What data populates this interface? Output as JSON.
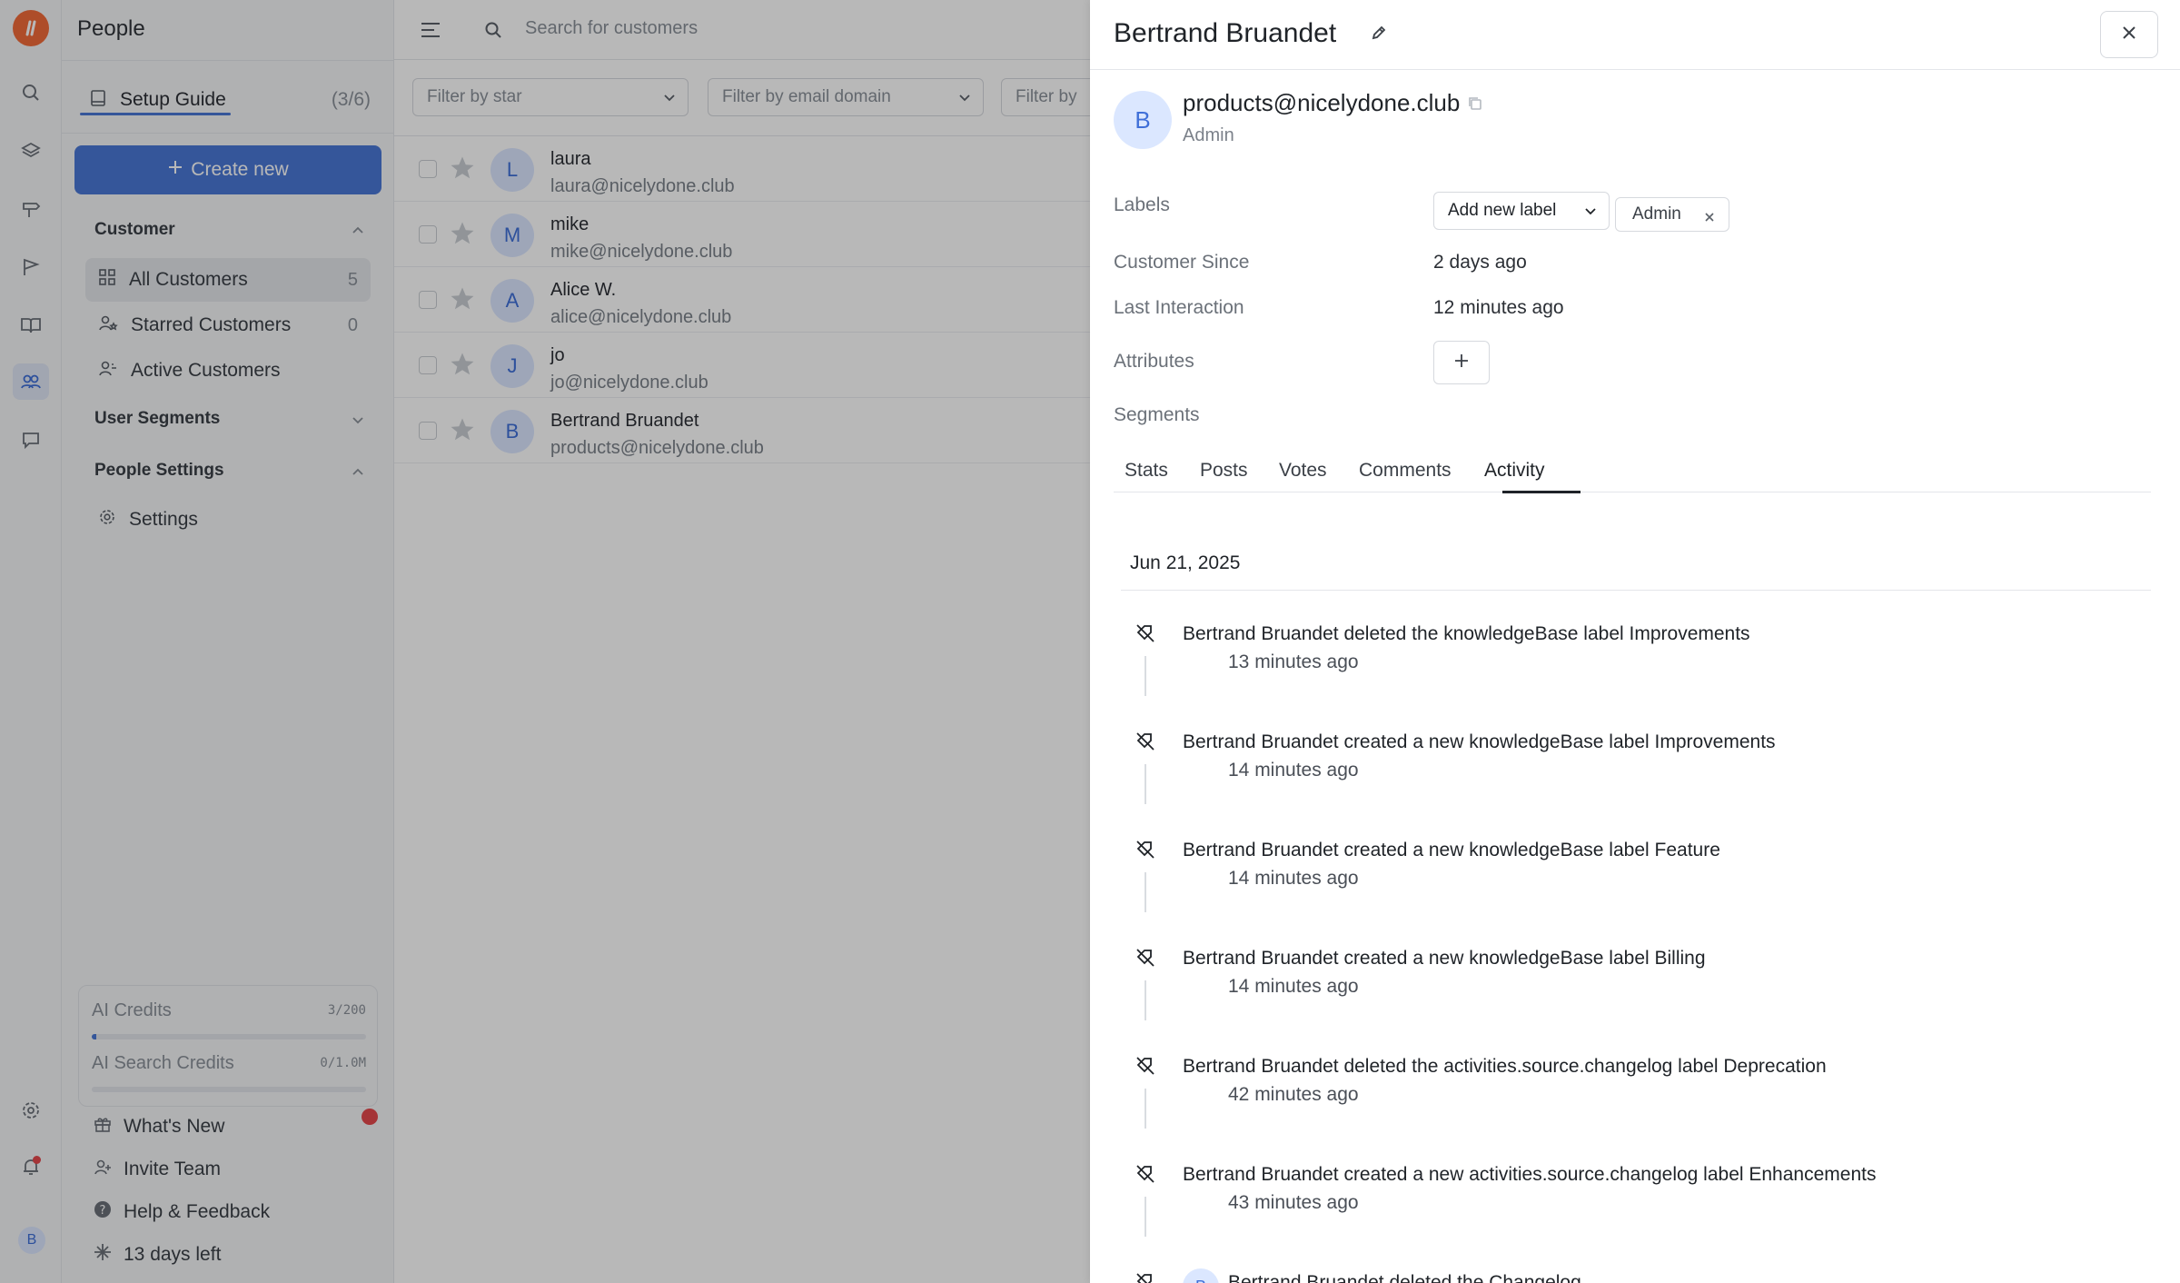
{
  "app": {
    "section_title": "People"
  },
  "sidebar": {
    "setup_guide": {
      "label": "Setup Guide",
      "count": "(3/6)"
    },
    "create_new": "Create new",
    "customer_section": "Customer",
    "items": [
      {
        "label": "All Customers",
        "count": "5"
      },
      {
        "label": "Starred Customers",
        "count": "0"
      },
      {
        "label": "Active Customers",
        "count": ""
      }
    ],
    "user_segments": "User Segments",
    "people_settings": "People Settings",
    "settings": "Settings",
    "credits": [
      {
        "label": "AI Credits",
        "value": "3/200",
        "progress_percent": 1.5
      },
      {
        "label": "AI Search Credits",
        "value": "0/1.0M",
        "progress_percent": 0
      }
    ],
    "footer": {
      "whats_new": "What's New",
      "invite_team": "Invite Team",
      "help": "Help & Feedback",
      "trial": "13 days left"
    },
    "user_initial": "B"
  },
  "list": {
    "search_placeholder": "Search for customers",
    "filters": [
      "Filter by star",
      "Filter by email domain",
      "Filter by"
    ],
    "rows": [
      {
        "initial": "L",
        "name": "laura",
        "email": "laura@nicelydone.club"
      },
      {
        "initial": "M",
        "name": "mike",
        "email": "mike@nicelydone.club"
      },
      {
        "initial": "A",
        "name": "Alice W.",
        "email": "alice@nicelydone.club"
      },
      {
        "initial": "J",
        "name": "jo",
        "email": "jo@nicelydone.club"
      },
      {
        "initial": "B",
        "name": "Bertrand Bruandet",
        "email": "products@nicelydone.club"
      }
    ]
  },
  "drawer": {
    "name": "Bertrand Bruandet",
    "initial": "B",
    "email": "products@nicelydone.club",
    "role": "Admin",
    "fields": {
      "labels_key": "Labels",
      "add_label": "Add new label",
      "label_chip": "Admin",
      "customer_since_key": "Customer Since",
      "customer_since_val": "2 days ago",
      "last_interaction_key": "Last Interaction",
      "last_interaction_val": "12 minutes ago",
      "attributes_key": "Attributes",
      "segments_key": "Segments"
    },
    "tabs": [
      "Stats",
      "Posts",
      "Votes",
      "Comments",
      "Activity"
    ],
    "active_tab": "Activity",
    "date": "Jun 21, 2025",
    "activities": [
      {
        "text": "Bertrand Bruandet deleted the knowledgeBase label Improvements",
        "time": "13 minutes ago"
      },
      {
        "text": "Bertrand Bruandet created a new knowledgeBase label Improvements",
        "time": "14 minutes ago"
      },
      {
        "text": "Bertrand Bruandet created a new knowledgeBase label Feature",
        "time": "14 minutes ago"
      },
      {
        "text": "Bertrand Bruandet created a new knowledgeBase label Billing",
        "time": "14 minutes ago"
      },
      {
        "text": "Bertrand Bruandet deleted the activities.source.changelog label Deprecation",
        "time": "42 minutes ago"
      },
      {
        "text": "Bertrand Bruandet created a new activities.source.changelog label Enhancements",
        "time": "43 minutes ago"
      },
      {
        "text": "Bertrand Bruandet deleted the Changelog",
        "time": ""
      }
    ]
  },
  "colors": {
    "accent": "#4a78d6",
    "brand": "#f26b3a",
    "notification": "#e5484d",
    "avatar_bg": "#dbe7ff"
  }
}
